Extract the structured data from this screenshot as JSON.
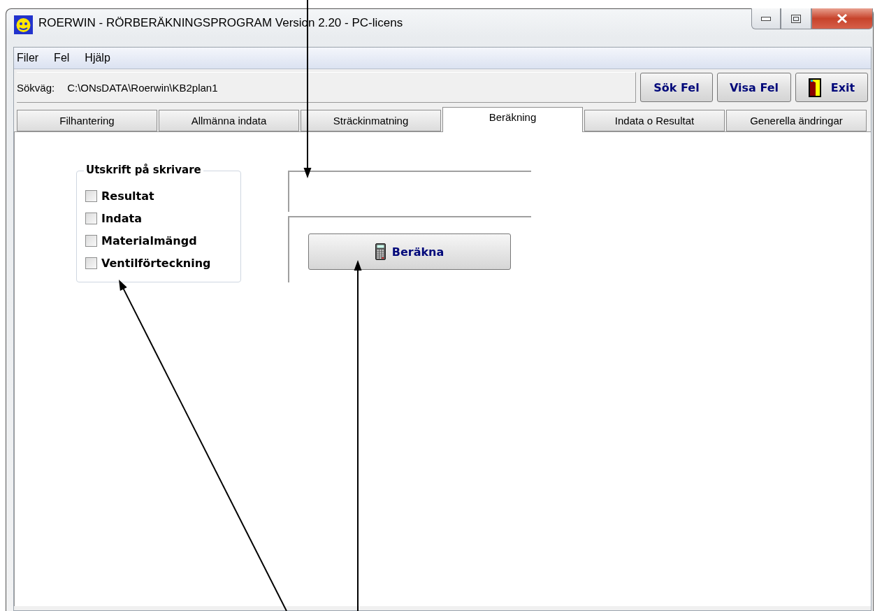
{
  "window": {
    "title": "ROERWIN - RÖRBERÄKNINGSPROGRAM Version 2.20 - PC-licens"
  },
  "menu": [
    "Filer",
    "Fel",
    "Hjälp"
  ],
  "path": {
    "label": "Sökväg:",
    "value": "C:\\ONsDATA\\Roerwin\\KB2plan1"
  },
  "toolbar_buttons": [
    {
      "label": "Sök Fel",
      "kind": "text"
    },
    {
      "label": "Visa Fel",
      "kind": "text"
    },
    {
      "label": "Exit",
      "kind": "exit"
    }
  ],
  "tabs": [
    {
      "label": "Filhantering",
      "selected": false
    },
    {
      "label": "Allmänna indata",
      "selected": false
    },
    {
      "label": "Sträckinmatning",
      "selected": false
    },
    {
      "label": "Beräkning",
      "selected": true
    },
    {
      "label": "Indata o Resultat",
      "selected": false
    },
    {
      "label": "Generella ändringar",
      "selected": false
    }
  ],
  "print_group": {
    "title": "Utskrift på skrivare",
    "options": [
      {
        "label": "Resultat",
        "checked": false
      },
      {
        "label": "Indata",
        "checked": false
      },
      {
        "label": "Materialmängd",
        "checked": false
      },
      {
        "label": "Ventilförteckning",
        "checked": false
      }
    ]
  },
  "calculate_button": {
    "label": "Beräkna"
  }
}
